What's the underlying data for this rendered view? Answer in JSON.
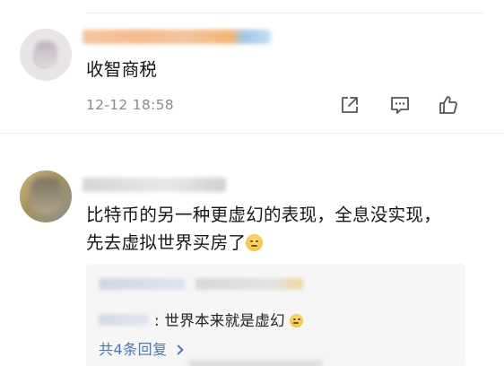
{
  "comments": [
    {
      "username": "",
      "text": "收智商税",
      "timestamp": "12-12 18:58",
      "actions": {
        "share_icon": "share-icon",
        "reply_icon": "comment-icon",
        "like_icon": "thumbs-up-icon"
      }
    },
    {
      "username": "",
      "text": "比特币的另一种更虚幻的表现，全息没实现，先去虚拟世界买房了",
      "replies": [
        {
          "username": "",
          "text": ""
        },
        {
          "username": "",
          "text": ": 世界本来就是虚幻"
        }
      ],
      "more_replies_label": "共4条回复"
    }
  ],
  "colors": {
    "link_blue": "#4a78b5",
    "timestamp_gray": "#8a8a8a",
    "reply_bg": "#f6f6f6"
  }
}
